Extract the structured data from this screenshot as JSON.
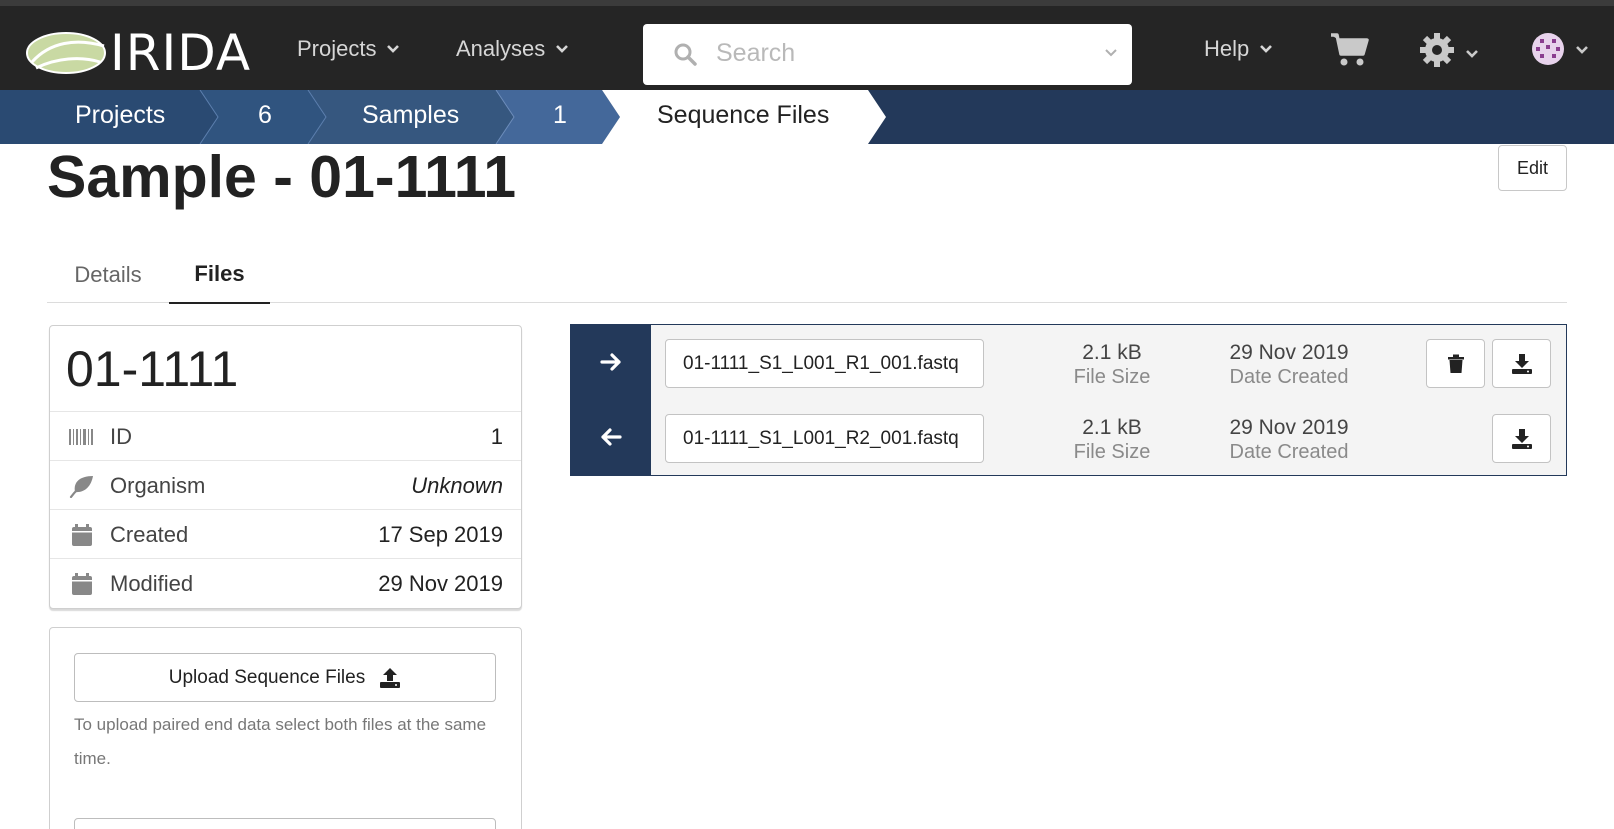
{
  "app": {
    "name": "IRIDA"
  },
  "nav": {
    "projects": "Projects",
    "analyses": "Analyses",
    "search_placeholder": "Search",
    "help": "Help"
  },
  "icons": {
    "search": "search-icon",
    "cart": "cart-icon",
    "settings": "gear-icon",
    "user": "user-avatar"
  },
  "breadcrumb": [
    "Projects",
    "6",
    "Samples",
    "1",
    "Sequence Files"
  ],
  "page": {
    "title": "Sample - 01-1111",
    "edit_label": "Edit"
  },
  "tabs": [
    "Details",
    "Files"
  ],
  "active_tab": "Files",
  "sample": {
    "name": "01-1111",
    "meta": [
      {
        "label": "ID",
        "value": "1",
        "icon": "barcode-icon"
      },
      {
        "label": "Organism",
        "value": "Unknown",
        "icon": "leaf-icon"
      },
      {
        "label": "Created",
        "value": "17 Sep 2019",
        "icon": "calendar-icon"
      },
      {
        "label": "Modified",
        "value": "29 Nov 2019",
        "icon": "calendar-icon"
      }
    ]
  },
  "upload": {
    "button_label": "Upload Sequence Files",
    "help_text": "To upload paired end data select both files at the same time."
  },
  "files": [
    {
      "direction": "forward",
      "name": "01-1111_S1_L001_R1_001.fastq",
      "size": "2.1 kB",
      "size_label": "File Size",
      "date": "29 Nov 2019",
      "date_label": "Date Created",
      "can_delete": true
    },
    {
      "direction": "reverse",
      "name": "01-1111_S1_L001_R2_001.fastq",
      "size": "2.1 kB",
      "size_label": "File Size",
      "date": "29 Nov 2019",
      "date_label": "Date Created",
      "can_delete": false
    }
  ],
  "colors": {
    "topbar": "#252525",
    "breadcrumb": "#23395a",
    "crumb_mid": "#36577f",
    "accent_dark": "#23395a"
  }
}
